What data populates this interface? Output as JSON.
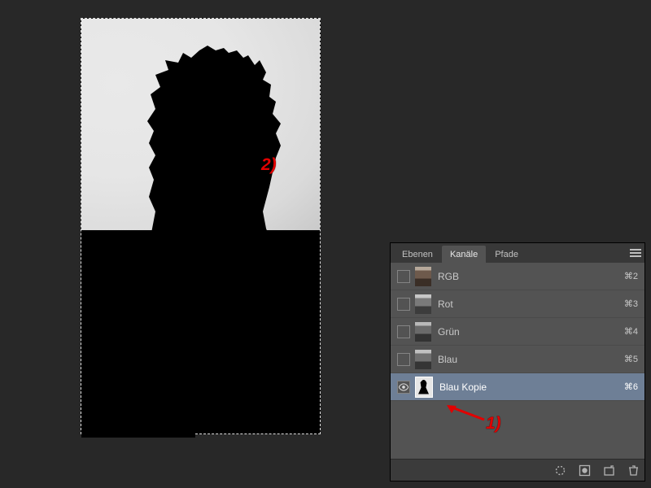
{
  "annotations": {
    "canvas": "2)",
    "panel": "1)"
  },
  "panel": {
    "tabs": {
      "layers": "Ebenen",
      "channels": "Kanäle",
      "paths": "Pfade"
    },
    "rows": [
      {
        "name": "RGB",
        "shortcut": "⌘2",
        "visible": false,
        "selected": false,
        "thumb": "rgb"
      },
      {
        "name": "Rot",
        "shortcut": "⌘3",
        "visible": false,
        "selected": false,
        "thumb": "r"
      },
      {
        "name": "Grün",
        "shortcut": "⌘4",
        "visible": false,
        "selected": false,
        "thumb": "g"
      },
      {
        "name": "Blau",
        "shortcut": "⌘5",
        "visible": false,
        "selected": false,
        "thumb": "b"
      },
      {
        "name": "Blau Kopie",
        "shortcut": "⌘6",
        "visible": true,
        "selected": true,
        "thumb": "copy"
      }
    ]
  }
}
